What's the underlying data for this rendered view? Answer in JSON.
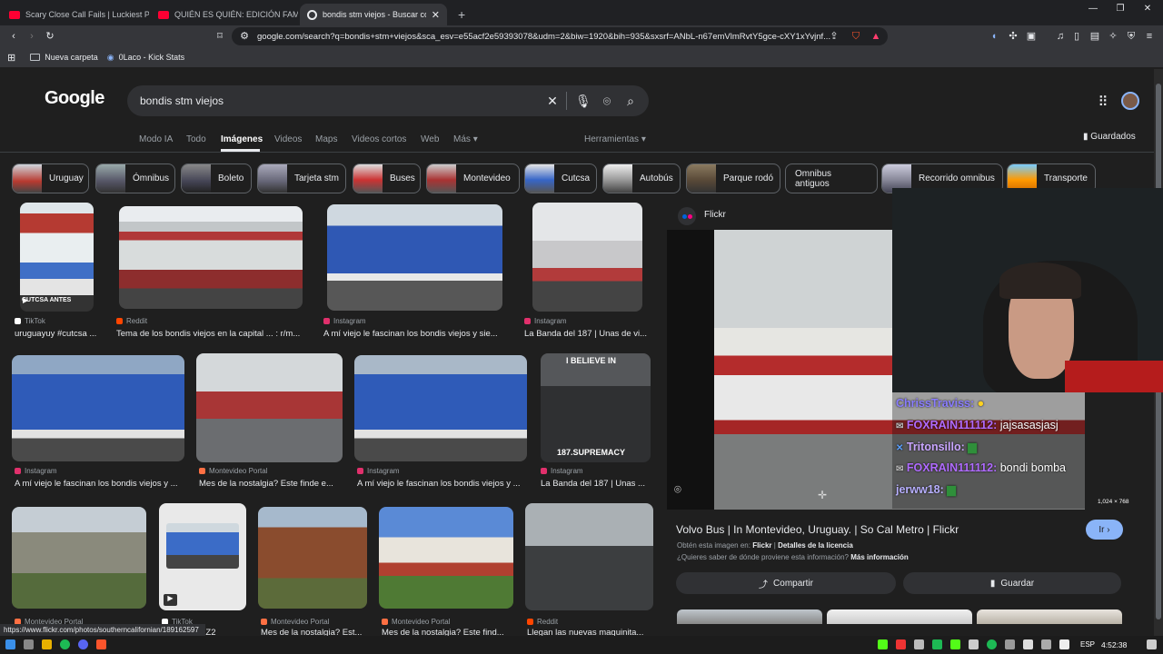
{
  "browser": {
    "tabs": [
      {
        "title": "Scary Close Call Fails | Luckiest Peop..."
      },
      {
        "title": "QUIÉN ES QUIÉN: EDICIÓN FAMOSO..."
      },
      {
        "title": "bondis stm viejos - Buscar con Google"
      }
    ],
    "new_tab": "+",
    "url": "google.com/search?q=bondis+stm+viejos&sca_esv=e55acf2e59393078&udm=2&biw=1920&bih=935&sxsrf=ANbL-n67emVlmRvtY5gce-cXY1xYvjnf...",
    "bookmarks": [
      {
        "label": "Nueva carpeta"
      },
      {
        "label": "0Laco - Kick Stats"
      }
    ]
  },
  "google": {
    "logo": "Google",
    "query": "bondis stm viejos",
    "nav_tabs": [
      "Modo IA",
      "Todo",
      "Imágenes",
      "Videos",
      "Maps",
      "Videos cortos",
      "Web",
      "Más"
    ],
    "tools": "Herramientas",
    "saved": "Guardados",
    "chips": [
      "Uruguay",
      "Ómnibus",
      "Boleto",
      "Tarjeta stm",
      "Buses",
      "Montevideo",
      "Cutcsa",
      "Autobús",
      "Parque rodó",
      "Omnibus antiguos",
      "Recorrido omnibus",
      "Transporte"
    ],
    "results": [
      {
        "source": "TikTok",
        "caption": "uruguayuy #cutcsa ...",
        "overlay": "CUTCSA ANTES"
      },
      {
        "source": "Reddit",
        "caption": "Tema de los bondis viejos en la capital ... : r/m..."
      },
      {
        "source": "Instagram",
        "caption": "A mí viejo le fascinan los bondis viejos y sie..."
      },
      {
        "source": "Instagram",
        "caption": "La Banda del 187 | Unas de vi..."
      },
      {
        "source": "Instagram",
        "caption": "A mí viejo le fascinan los bondis viejos y ..."
      },
      {
        "source": "Montevideo Portal",
        "caption": "Mes de la nostalgia? Este finde e..."
      },
      {
        "source": "Instagram",
        "caption": "A mí viejo le fascinan los bondis viejos y ..."
      },
      {
        "source": "Instagram",
        "caption": "La Banda del 187 | Unas ...",
        "overlay_top": "I BELIEVE IN",
        "overlay_bottom": "187.SUPREMACY"
      },
      {
        "source": "Montevideo Portal",
        "caption": ""
      },
      {
        "source": "TikTok",
        "caption": "...nea Z2"
      },
      {
        "source": "Montevideo Portal",
        "caption": "Mes de la nostalgia? Est..."
      },
      {
        "source": "Montevideo Portal",
        "caption": "Mes de la nostalgia? Este find..."
      },
      {
        "source": "Reddit",
        "caption": "Llegan las nuevas maquinita..."
      }
    ]
  },
  "panel": {
    "source": "Flickr",
    "resolution": "1,024 × 768",
    "title": "Volvo Bus | In Montevideo, Uruguay. | So Cal Metro | Flickr",
    "go_button": "Ir",
    "found_in_prefix": "Obtén esta imagen en:",
    "found_in_site": "Flickr",
    "license": "Detalles de la licencia",
    "question": "¿Quieres saber de dónde proviene esta información?",
    "more_info": "Más información",
    "share": "Compartir",
    "save": "Guardar"
  },
  "chat": [
    {
      "user": "ChrissTraviss:",
      "message": "",
      "color": "#8a7dff"
    },
    {
      "user": "FOXRAIN111112:",
      "message": "jajsasasjasj",
      "color": "#b06bff"
    },
    {
      "user": "Tritonsillo:",
      "message": "",
      "color": "#c9a6ff"
    },
    {
      "user": "FOXRAIN111112:",
      "message": "bondi bomba",
      "color": "#b06bff"
    },
    {
      "user": "jerww18:",
      "message": "",
      "color": "#b8b0ff"
    }
  ],
  "status_url": "https://www.flickr.com/photos/southerncalifornian/189162597",
  "taskbar": {
    "lang": "ESP",
    "time": "4:52:38"
  }
}
